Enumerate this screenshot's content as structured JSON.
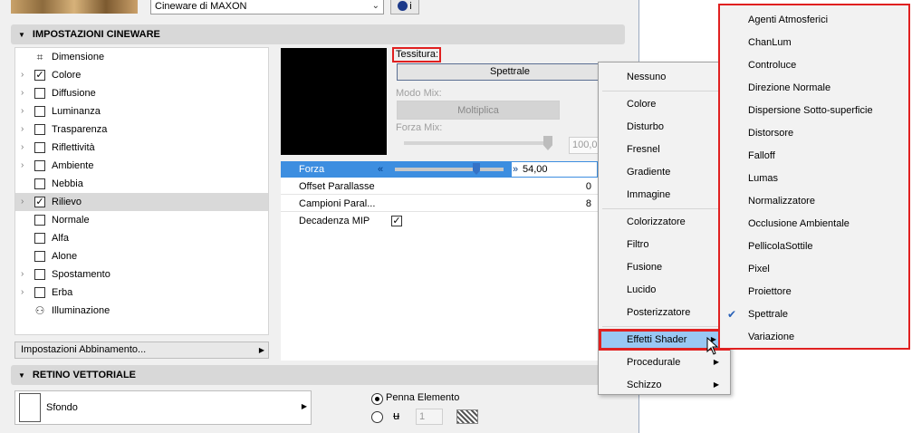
{
  "top": {
    "engine_value": "Cineware di MAXON",
    "info_label": "i"
  },
  "sections": {
    "cineware_title": "IMPOSTAZIONI CINEWARE",
    "retino_title": "RETINO VETTORIALE"
  },
  "channels": [
    {
      "label": "Dimensione",
      "expandable": false,
      "kind": "icon",
      "icon": "dimension-icon"
    },
    {
      "label": "Colore",
      "expandable": true,
      "kind": "checkbox",
      "checked": true
    },
    {
      "label": "Diffusione",
      "expandable": true,
      "kind": "checkbox",
      "checked": false
    },
    {
      "label": "Luminanza",
      "expandable": true,
      "kind": "checkbox",
      "checked": false
    },
    {
      "label": "Trasparenza",
      "expandable": true,
      "kind": "checkbox",
      "checked": false
    },
    {
      "label": "Riflettività",
      "expandable": true,
      "kind": "checkbox",
      "checked": false
    },
    {
      "label": "Ambiente",
      "expandable": true,
      "kind": "checkbox",
      "checked": false
    },
    {
      "label": "Nebbia",
      "expandable": false,
      "kind": "checkbox",
      "checked": false
    },
    {
      "label": "Rilievo",
      "expandable": true,
      "kind": "checkbox",
      "checked": true,
      "selected": true
    },
    {
      "label": "Normale",
      "expandable": false,
      "kind": "checkbox",
      "checked": false
    },
    {
      "label": "Alfa",
      "expandable": false,
      "kind": "checkbox",
      "checked": false
    },
    {
      "label": "Alone",
      "expandable": false,
      "kind": "checkbox",
      "checked": false
    },
    {
      "label": "Spostamento",
      "expandable": true,
      "kind": "checkbox",
      "checked": false
    },
    {
      "label": "Erba",
      "expandable": true,
      "kind": "checkbox",
      "checked": false
    },
    {
      "label": "Illuminazione",
      "expandable": false,
      "kind": "icon",
      "icon": "illumination-icon"
    }
  ],
  "match_settings_label": "Impostazioni Abbinamento...",
  "texture": {
    "label": "Tessitura:",
    "shader_button": "Spettrale",
    "mix_mode_label": "Modo Mix:",
    "mix_mode_value": "Moltiplica",
    "mix_strength_label": "Forza Mix:",
    "mix_strength_value": "100,0"
  },
  "params": {
    "forza_label": "Forza",
    "forza_value": "54,00",
    "offset_label": "Offset Parallasse",
    "offset_value": "0",
    "campioni_label": "Campioni Paral...",
    "campioni_value": "8",
    "mip_label": "Decadenza MIP",
    "mip_checked": true
  },
  "retino": {
    "sfondo_label": "Sfondo",
    "pen_element_label": "Penna Elemento",
    "pen_number": "1"
  },
  "context_menu": {
    "groups": [
      [
        "Nessuno"
      ],
      [
        "Colore",
        "Disturbo",
        "Fresnel",
        "Gradiente",
        "Immagine"
      ],
      [
        "Colorizzatore",
        "Filtro",
        "Fusione",
        "Lucido",
        "Posterizzatore"
      ],
      [
        "Effetti Shader",
        "Procedurale",
        "Schizzo"
      ]
    ],
    "highlighted": "Effetti Shader",
    "with_submenu": [
      "Effetti Shader",
      "Procedurale",
      "Schizzo"
    ]
  },
  "submenu": {
    "items": [
      "Agenti Atmosferici",
      "ChanLum",
      "Controluce",
      "Direzione Normale",
      "Dispersione Sotto-superficie",
      "Distorsore",
      "Falloff",
      "Lumas",
      "Normalizzatore",
      "Occlusione Ambientale",
      "PellicolaSottile",
      "Pixel",
      "Proiettore",
      "Spettrale",
      "Variazione"
    ],
    "checked": "Spettrale"
  },
  "colors": {
    "highlight_border": "#e02020",
    "selection_blue": "#3d8ee0",
    "menu_highlight": "#99c8f4"
  }
}
